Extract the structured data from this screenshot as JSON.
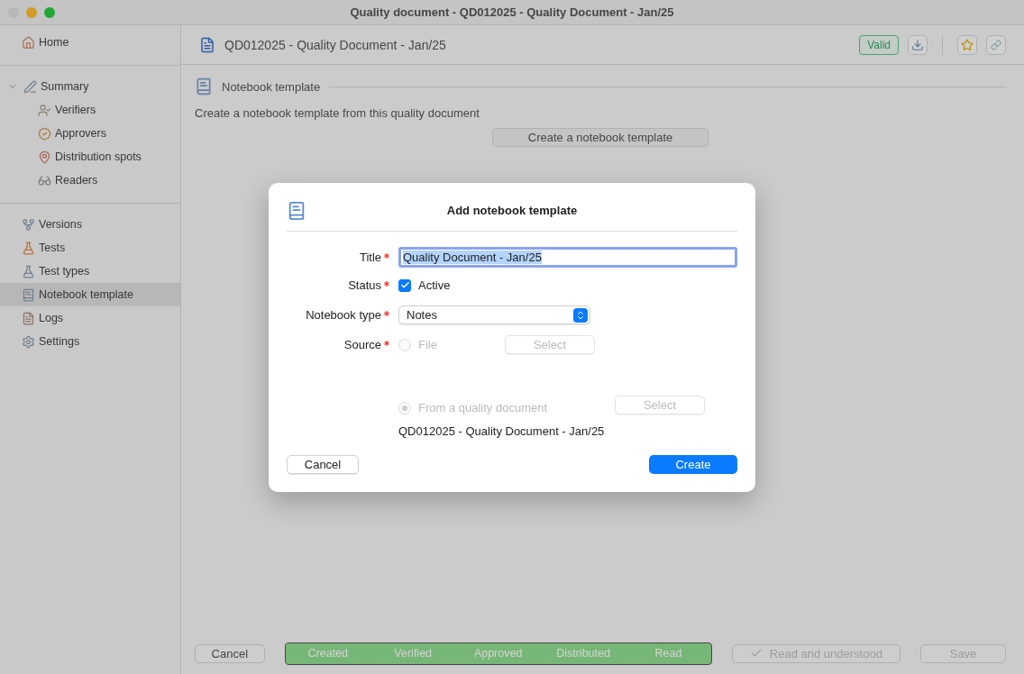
{
  "window": {
    "title": "Quality document - QD012025 - Quality Document - Jan/25"
  },
  "sidebar": {
    "sections": [
      {
        "items": [
          {
            "label": "Home",
            "selected": false
          }
        ]
      },
      {
        "items": [
          {
            "label": "Summary",
            "selected": false,
            "expanded": true,
            "children": [
              {
                "label": "Verifiers",
                "selected": false
              },
              {
                "label": "Approvers",
                "selected": false
              },
              {
                "label": "Distribution spots",
                "selected": false
              },
              {
                "label": "Readers",
                "selected": false
              }
            ]
          }
        ]
      },
      {
        "items": [
          {
            "label": "Versions",
            "selected": false
          },
          {
            "label": "Tests",
            "selected": false
          },
          {
            "label": "Test types",
            "selected": false
          },
          {
            "label": "Notebook template",
            "selected": true
          },
          {
            "label": "Logs",
            "selected": false
          },
          {
            "label": "Settings",
            "selected": false
          }
        ]
      }
    ]
  },
  "header": {
    "title": "QD012025 - Quality Document - Jan/25",
    "badge": "Valid"
  },
  "section": {
    "title": "Notebook template",
    "description": "Create a notebook template from this quality document",
    "button": "Create a notebook template"
  },
  "footer": {
    "cancel": "Cancel",
    "steps": [
      {
        "label": "Created",
        "done": true
      },
      {
        "label": "Verified",
        "done": true
      },
      {
        "label": "Approved",
        "done": true
      },
      {
        "label": "Distributed",
        "done": true
      },
      {
        "label": "Read",
        "done": true
      }
    ],
    "read_button": {
      "label": "Read and understood",
      "disabled": true
    },
    "save": {
      "label": "Save",
      "disabled": true
    }
  },
  "dialog": {
    "title": "Add notebook template",
    "title_field": {
      "label": "Title",
      "required": true,
      "value": "Quality Document - Jan/25"
    },
    "status_field": {
      "label": "Status",
      "required": true,
      "option": "Active",
      "checked": true
    },
    "type_field": {
      "label": "Notebook type",
      "required": true,
      "value": "Notes"
    },
    "source_field": {
      "label": "Source",
      "required": true,
      "options": [
        {
          "label": "File",
          "selected": false,
          "disabled": true,
          "button": "Select"
        },
        {
          "label": "From a quality document",
          "selected": true,
          "disabled": true,
          "button": "Select"
        }
      ],
      "document": "QD012025 - Quality Document - Jan/25"
    },
    "cancel": "Cancel",
    "create": "Create"
  }
}
